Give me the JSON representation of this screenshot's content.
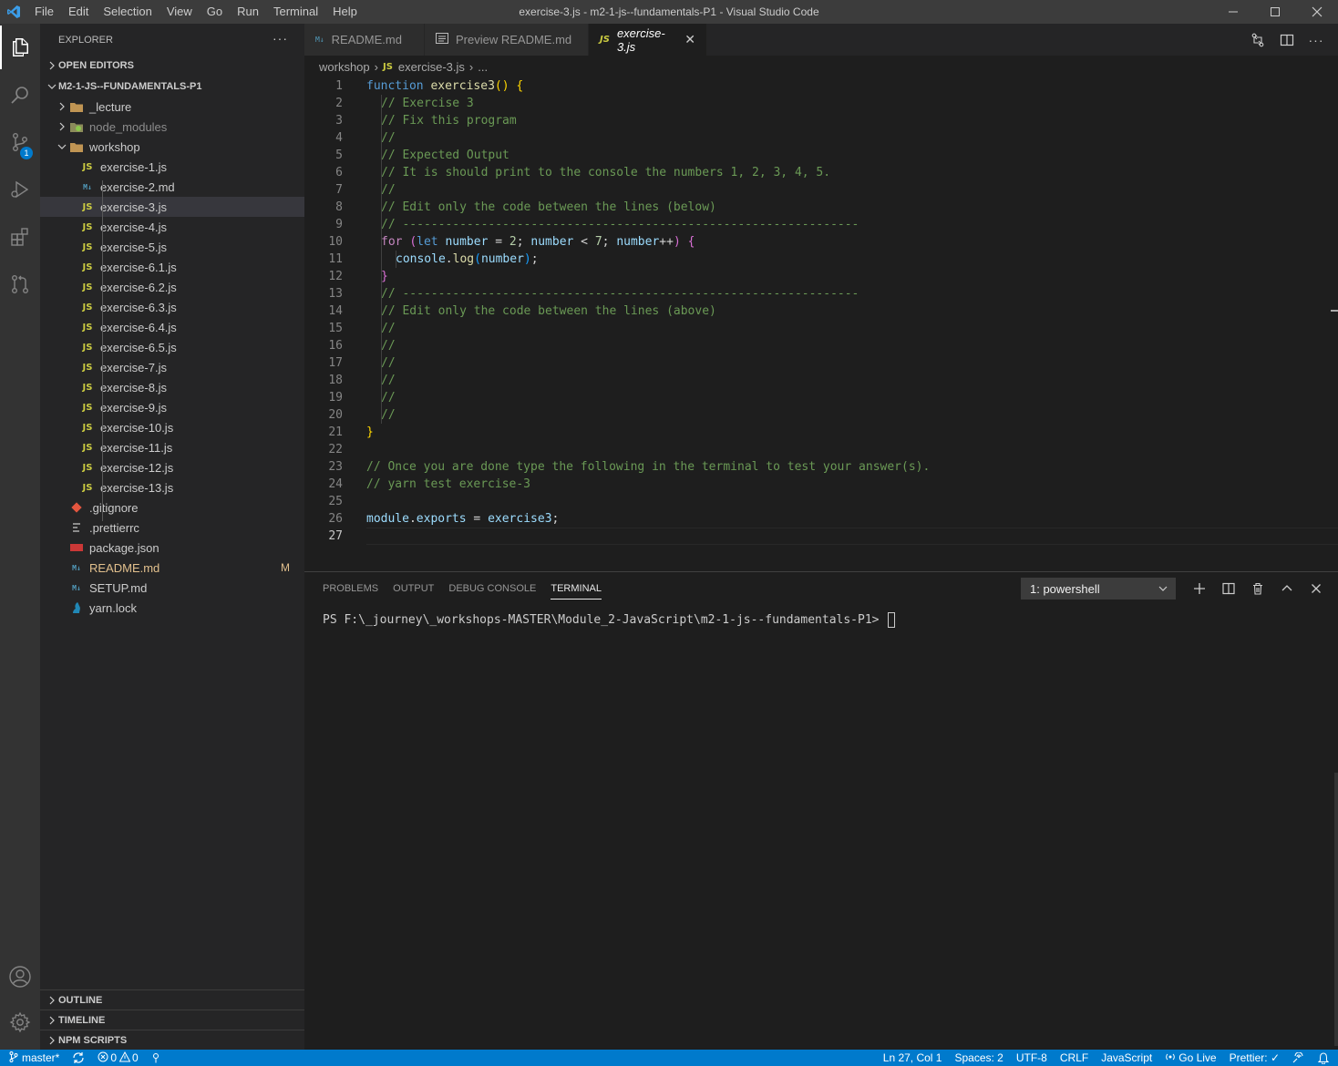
{
  "window": {
    "title": "exercise-3.js - m2-1-js--fundamentals-P1 - Visual Studio Code",
    "menu": [
      "File",
      "Edit",
      "Selection",
      "View",
      "Go",
      "Run",
      "Terminal",
      "Help"
    ]
  },
  "activity": {
    "scm_badge": "1",
    "icons": [
      "explorer-icon",
      "search-icon",
      "source-control-icon",
      "run-debug-icon",
      "extensions-icon",
      "pull-requests-icon",
      "account-icon",
      "settings-gear-icon"
    ]
  },
  "sidebar": {
    "header": "EXPLORER",
    "open_editors": "OPEN EDITORS",
    "project": "M2-1-JS--FUNDAMENTALS-P1",
    "folders": [
      {
        "name": "_lecture",
        "expanded": false
      },
      {
        "name": "node_modules",
        "expanded": false
      },
      {
        "name": "workshop",
        "expanded": true
      }
    ],
    "workshop_files": [
      {
        "name": "exercise-1.js",
        "type": "JS"
      },
      {
        "name": "exercise-2.md",
        "type": "M↓"
      },
      {
        "name": "exercise-3.js",
        "type": "JS"
      },
      {
        "name": "exercise-4.js",
        "type": "JS"
      },
      {
        "name": "exercise-5.js",
        "type": "JS"
      },
      {
        "name": "exercise-6.1.js",
        "type": "JS"
      },
      {
        "name": "exercise-6.2.js",
        "type": "JS"
      },
      {
        "name": "exercise-6.3.js",
        "type": "JS"
      },
      {
        "name": "exercise-6.4.js",
        "type": "JS"
      },
      {
        "name": "exercise-6.5.js",
        "type": "JS"
      },
      {
        "name": "exercise-7.js",
        "type": "JS"
      },
      {
        "name": "exercise-8.js",
        "type": "JS"
      },
      {
        "name": "exercise-9.js",
        "type": "JS"
      },
      {
        "name": "exercise-10.js",
        "type": "JS"
      },
      {
        "name": "exercise-11.js",
        "type": "JS"
      },
      {
        "name": "exercise-12.js",
        "type": "JS"
      },
      {
        "name": "exercise-13.js",
        "type": "JS"
      }
    ],
    "root_files": [
      {
        "name": ".gitignore"
      },
      {
        "name": ".prettierrc"
      },
      {
        "name": "package.json"
      },
      {
        "name": "README.md",
        "status": "M"
      },
      {
        "name": "SETUP.md"
      },
      {
        "name": "yarn.lock"
      }
    ],
    "bottom_sections": [
      "OUTLINE",
      "TIMELINE",
      "NPM SCRIPTS"
    ]
  },
  "tabs": [
    {
      "label": "README.md",
      "active": false
    },
    {
      "label": "Preview README.md",
      "active": false
    },
    {
      "label": "exercise-3.js",
      "active": true
    }
  ],
  "breadcrumb": [
    "workshop",
    "exercise-3.js",
    "..."
  ],
  "breadcrumb_js": "JS",
  "editor": {
    "line_numbers": [
      "1",
      "2",
      "3",
      "4",
      "5",
      "6",
      "7",
      "8",
      "9",
      "10",
      "11",
      "12",
      "13",
      "14",
      "15",
      "16",
      "17",
      "18",
      "19",
      "20",
      "21",
      "22",
      "23",
      "24",
      "25",
      "26",
      "27"
    ],
    "comments": {
      "l2": "// Exercise 3",
      "l3": "// Fix this program",
      "l4": "//",
      "l5": "// Expected Output",
      "l6": "// It is should print to the console the numbers 1, 2, 3, 4, 5.",
      "l7": "//",
      "l8": "// Edit only the code between the lines (below)",
      "l9": "// ----------------------------------------------------------------",
      "l13": "// ----------------------------------------------------------------",
      "l14": "// Edit only the code between the lines (above)",
      "l15": "//",
      "l16": "//",
      "l17": "//",
      "l18": "//",
      "l19": "//",
      "l20": "//",
      "l23": "// Once you are done type the following in the terminal to test your answer(s).",
      "l24": "// yarn test exercise-3"
    }
  },
  "panel": {
    "tabs": [
      "PROBLEMS",
      "OUTPUT",
      "DEBUG CONSOLE",
      "TERMINAL"
    ],
    "terminal_select": "1: powershell",
    "prompt": "PS F:\\_journey\\_workshops-MASTER\\Module_2-JavaScript\\m2-1-js--fundamentals-P1> "
  },
  "status": {
    "branch": "master*",
    "errors": "0",
    "warnings": "0",
    "position": "Ln 27, Col 1",
    "spaces": "Spaces: 2",
    "encoding": "UTF-8",
    "eol": "CRLF",
    "language": "JavaScript",
    "golive": "Go Live",
    "prettier": "Prettier: ✓"
  },
  "colors": {
    "accent": "#007acc",
    "title_bar": "#3c3c3c",
    "sidebar": "#252526",
    "editor_bg": "#1e1e1e",
    "comment": "#6a9955",
    "keyword": "#569cd6",
    "function": "#dcdcaa",
    "variable": "#9cdcfe",
    "number": "#b5cea8",
    "js_icon": "#cbcb41",
    "modified": "#e2c08d"
  }
}
